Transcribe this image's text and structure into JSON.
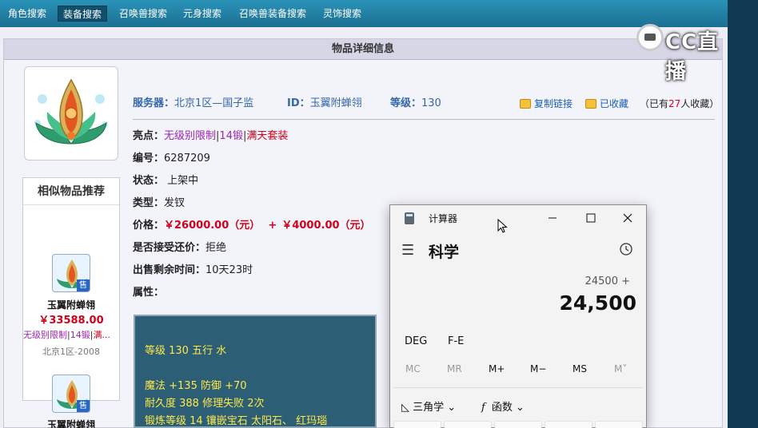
{
  "nav": {
    "items": [
      {
        "label": "角色搜索",
        "active": false
      },
      {
        "label": "装备搜索",
        "active": true
      },
      {
        "label": "召唤兽搜索",
        "active": false
      },
      {
        "label": "元身搜索",
        "active": false
      },
      {
        "label": "召唤兽装备搜索",
        "active": false
      },
      {
        "label": "灵饰搜索",
        "active": false
      }
    ]
  },
  "logo": {
    "text": "CC直播"
  },
  "panel": {
    "title": "物品详细信息"
  },
  "item": {
    "server_label": "服务器：",
    "server": "北京1区—国子监",
    "id_label": "ID：",
    "id": "玉翼附蝉翎",
    "level_label": "等级：",
    "level": "130",
    "copy_link": "复制链接",
    "favorited": "已收藏",
    "fav_prefix": "（已有",
    "fav_count": "27",
    "fav_suffix": "人收藏）",
    "highlights_label": "亮点：",
    "highlights": [
      "无级别限制",
      "14锻",
      "满天套装"
    ],
    "number_label": "编号：",
    "number": "6287209",
    "status_label": "状态：",
    "status": "上架中",
    "type_label": "类型：",
    "type": "发钗",
    "price_label": "价格：",
    "price": "￥26000.00（元）",
    "price_plus": "+",
    "price_extra": "￥4000.00（元）",
    "bargain_label": "是否接受还价：",
    "bargain": "拒绝",
    "remaining_label": "出售剩余时间：",
    "remaining": "10天23时",
    "attr_label": "属性：",
    "attributes": [
      "等级 130 五行 水",
      "魔法 +135 防御 +70",
      "耐久度 388 修理失败 2次",
      "锻炼等级 14 镶嵌宝石 太阳石、 红玛瑙"
    ]
  },
  "similar": {
    "title": "相似物品推荐",
    "sell_badge": "售",
    "items": [
      {
        "name": "玉翼附蝉翎",
        "price": "￥33588.00",
        "tags": [
          "无级别限制",
          "14锻",
          "满..."
        ],
        "server": "北京1区-2008"
      },
      {
        "name": "玉翼附蝉翎"
      }
    ]
  },
  "calculator": {
    "title": "计算器",
    "mode": "科学",
    "expression": "24500 +",
    "display": "24,500",
    "options": [
      "DEG",
      "F-E"
    ],
    "memory": [
      {
        "label": "MC",
        "enabled": false
      },
      {
        "label": "MR",
        "enabled": false
      },
      {
        "label": "M+",
        "enabled": true
      },
      {
        "label": "M−",
        "enabled": true
      },
      {
        "label": "MS",
        "enabled": true
      },
      {
        "label": "M˅",
        "enabled": false
      }
    ],
    "trig": "三角学",
    "func": "函数",
    "func_glyph": "f"
  }
}
